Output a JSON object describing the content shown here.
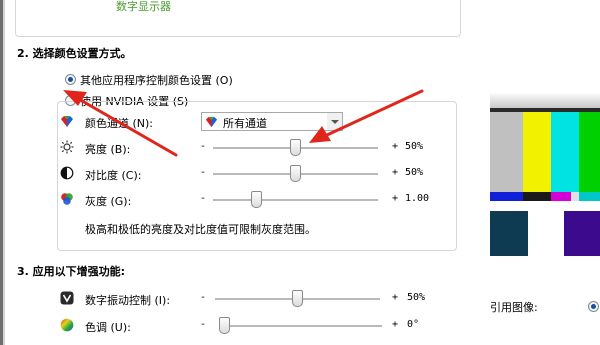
{
  "top": {
    "display_label": "数字显示器"
  },
  "section2": {
    "title": "2. 选择颜色设置方式。",
    "option_other_app": "其他应用程序控制颜色设置 (O)",
    "option_nvidia": "使用 NVIDIA 设置 (S)",
    "option_other_selected": true
  },
  "color_channel": {
    "label": "颜色通道 (N):",
    "selected": "所有通道"
  },
  "sliders": {
    "brightness": {
      "label": "亮度 (B):",
      "minus": "-",
      "plus": "+",
      "value": "50%",
      "level": 0.5
    },
    "contrast": {
      "label": "对比度 (C):",
      "minus": "-",
      "plus": "+",
      "value": "50%",
      "level": 0.5
    },
    "gamma": {
      "label": "灰度 (G):",
      "minus": "-",
      "plus": "+",
      "value": "1.00",
      "level": 0.25
    }
  },
  "note": "极高和极低的亮度及对比度值可限制灰度范围。",
  "section3": {
    "title": "3. 应用以下增强功能:",
    "vibrance": {
      "label": "数字振动控制 (I):",
      "minus": "-",
      "plus": "+",
      "value": "50%",
      "level": 0.5
    },
    "hue": {
      "label": "色调 (U):",
      "minus": "-",
      "plus": "+",
      "value": "0°",
      "level": 0.0
    }
  },
  "reference": {
    "label": "引用图像:"
  },
  "colors": {
    "arrow": "#e0261c",
    "radio_dot": "#1b4e9b",
    "sub_text": "#4a9a2e"
  }
}
